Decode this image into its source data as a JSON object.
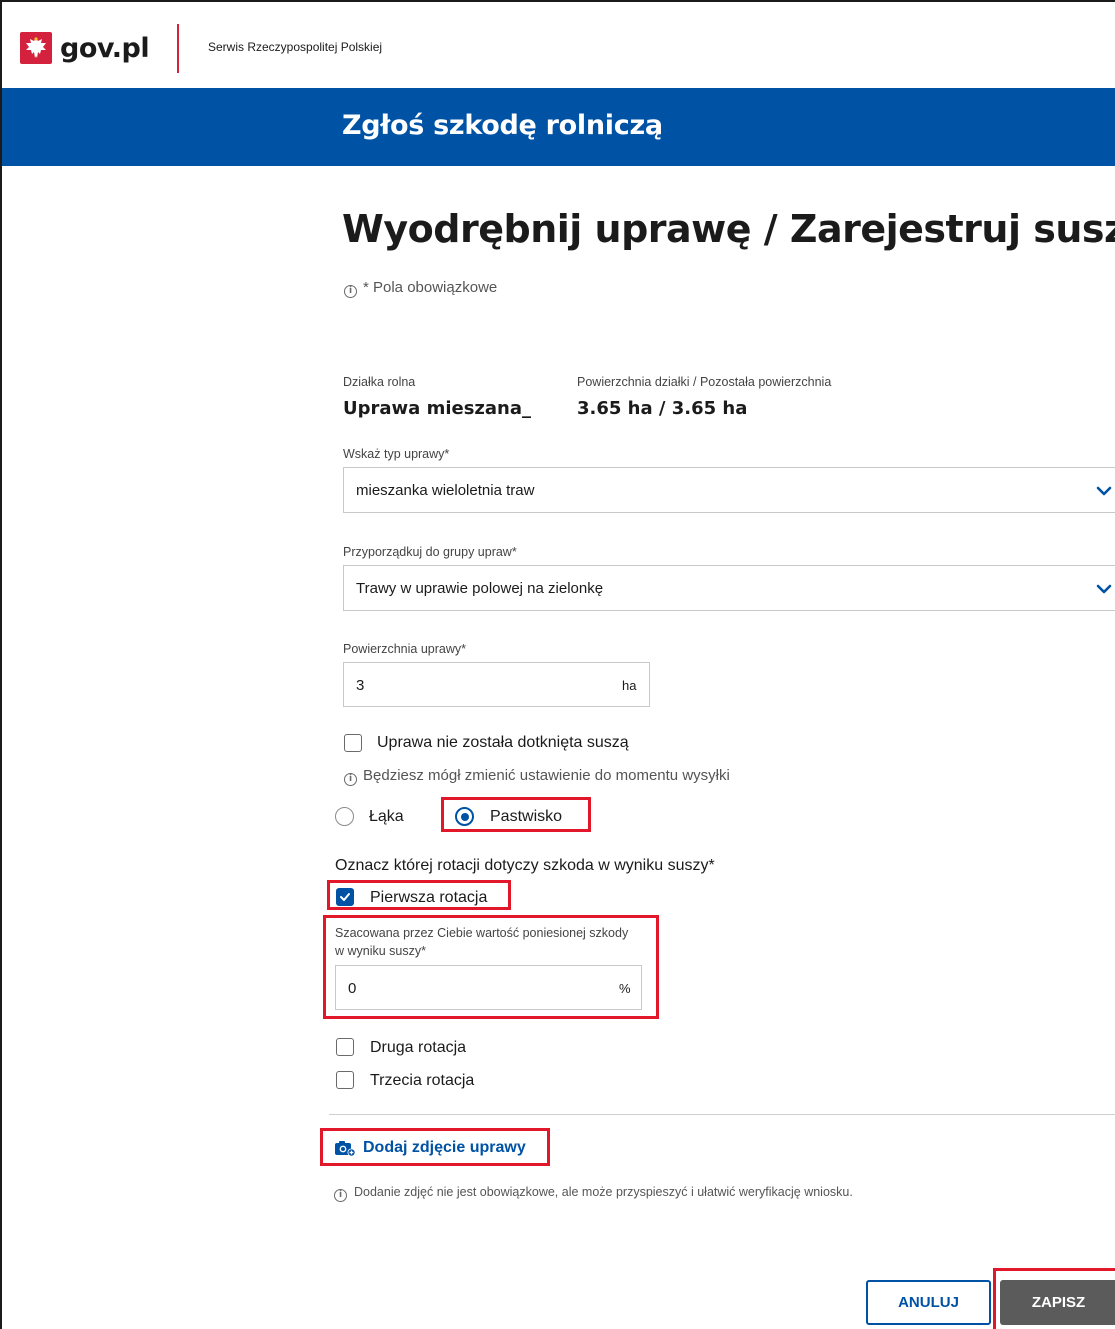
{
  "header": {
    "brand": "gov.pl",
    "service_name": "Serwis Rzeczypospolitej Polskiej",
    "banner_title": "Zgłoś szkodę rolniczą",
    "accent_color": "#0052a5",
    "brand_red": "#d4213d"
  },
  "page": {
    "title": "Wyodrębnij uprawę / Zarejestruj susz",
    "required_note": "* Pola obowiązkowe"
  },
  "parcel": {
    "label": "Działka rolna",
    "value": "Uprawa mieszana_",
    "area_label": "Powierzchnia działki / Pozostała powierzchnia",
    "area_value": "3.65 ha / 3.65 ha"
  },
  "crop_type": {
    "label": "Wskaż typ uprawy*",
    "selected": "mieszanka wieloletnia traw"
  },
  "crop_group": {
    "label": "Przyporządkuj do grupy upraw*",
    "selected": "Trawy w uprawie polowej na zielonkę"
  },
  "crop_area": {
    "label": "Powierzchnia uprawy*",
    "value": "3",
    "unit": "ha"
  },
  "not_affected": {
    "label": "Uprawa nie została dotknięta suszą",
    "checked": false,
    "note": "Będziesz mógł zmienić ustawienie do momentu wysyłki"
  },
  "land_use": {
    "options": [
      "Łąka",
      "Pastwisko"
    ],
    "selected": "Pastwisko"
  },
  "rotation": {
    "question": "Oznacz której rotacji dotyczy szkoda w wyniku suszy*",
    "first": {
      "label": "Pierwsza rotacja",
      "checked": true
    },
    "damage_label": "Szacowana przez Ciebie wartość poniesionej szkody w wyniku suszy*",
    "damage_value": "0",
    "damage_unit": "%",
    "second": {
      "label": "Druga rotacja",
      "checked": false
    },
    "third": {
      "label": "Trzecia rotacja",
      "checked": false
    }
  },
  "photo": {
    "add_label": "Dodaj zdjęcie uprawy",
    "note": "Dodanie zdjęć nie jest obowiązkowe, ale może przyspieszyć i ułatwić weryfikację wniosku."
  },
  "actions": {
    "cancel": "ANULUJ",
    "save": "ZAPISZ"
  },
  "icons": {
    "info": "info-icon",
    "chevron": "chevron-down-icon",
    "camera": "camera-plus-icon",
    "logo": "eagle-emblem-icon"
  },
  "highlight_color": "#e2182a"
}
